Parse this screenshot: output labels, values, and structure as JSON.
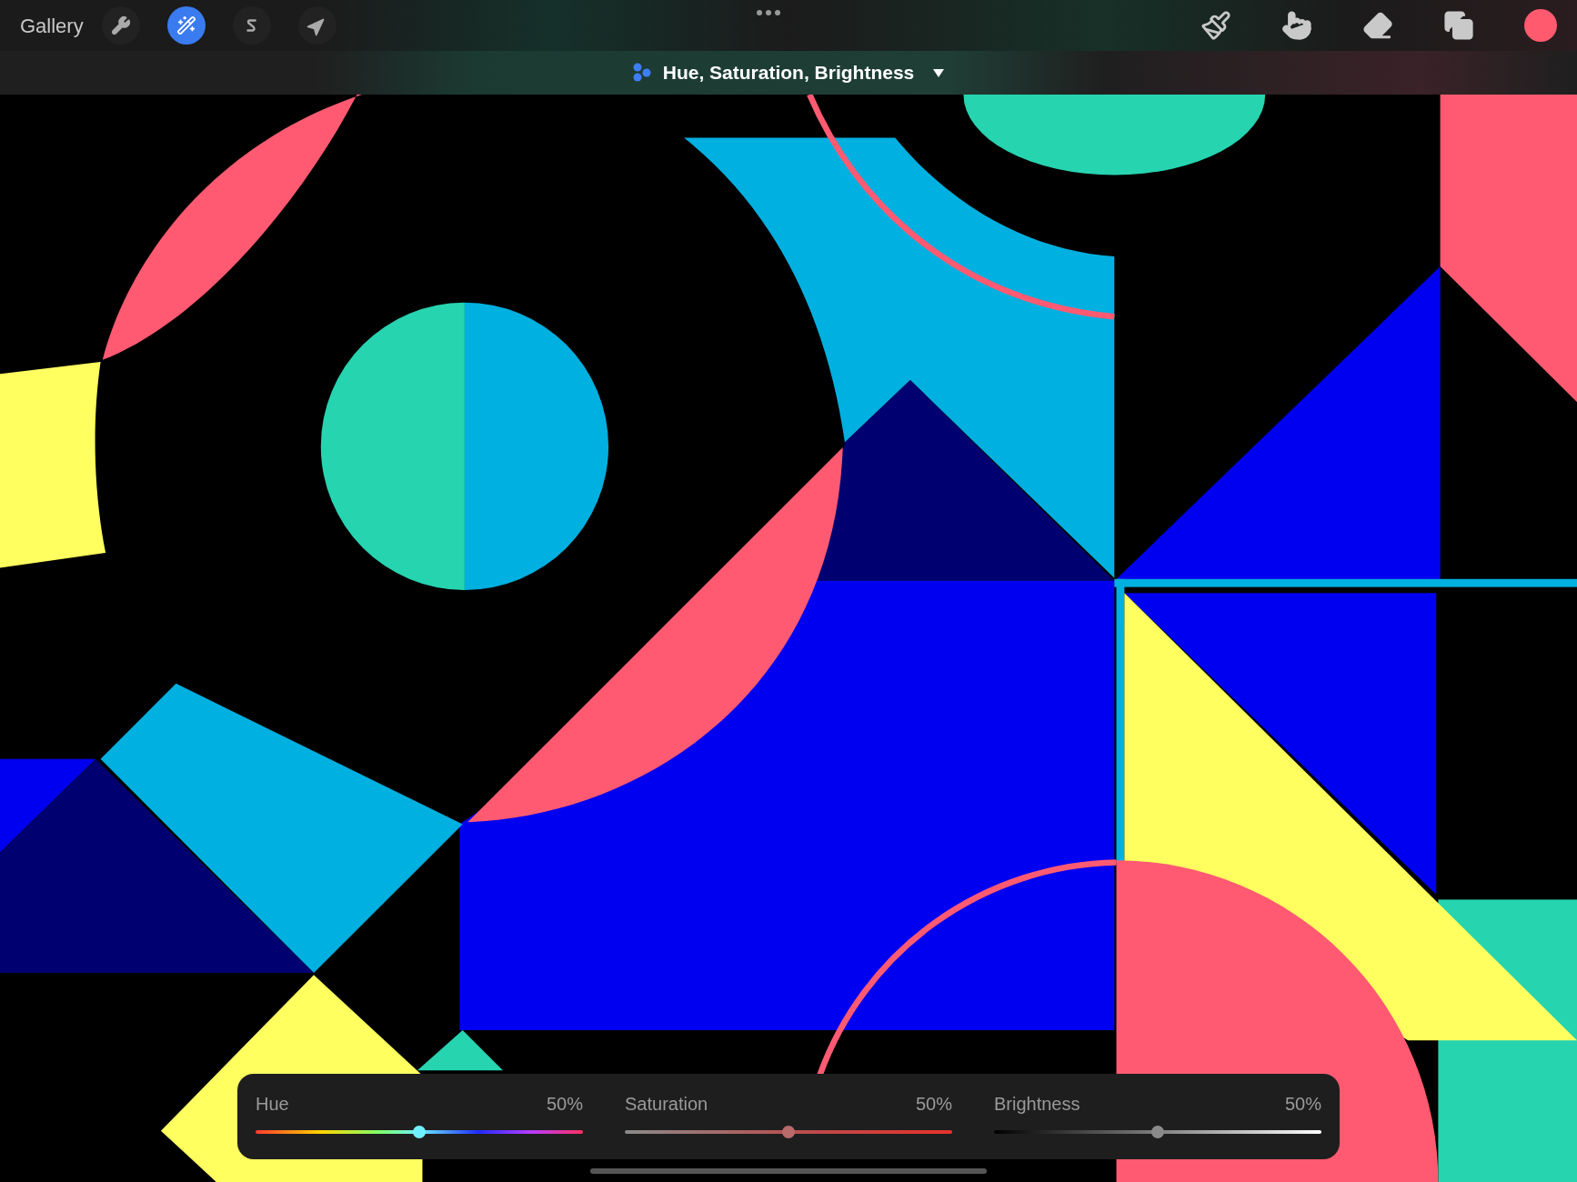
{
  "toolbar": {
    "gallery": "Gallery",
    "tools": [
      {
        "kind": "wrench",
        "selected": false
      },
      {
        "kind": "wand",
        "selected": true
      },
      {
        "kind": "selection",
        "selected": false
      },
      {
        "kind": "transform",
        "selected": false
      }
    ],
    "paint_tools": [
      {
        "kind": "brush"
      },
      {
        "kind": "smudge"
      },
      {
        "kind": "eraser"
      },
      {
        "kind": "layers"
      }
    ],
    "color": "#ff5a6e"
  },
  "adjustment": {
    "title": "Hue, Saturation, Brightness"
  },
  "sliders": [
    {
      "kind": "hue",
      "label": "Hue",
      "reading": "50%",
      "level": 0.5
    },
    {
      "kind": "saturation",
      "label": "Saturation",
      "reading": "50%",
      "level": 0.5
    },
    {
      "kind": "brightness",
      "label": "Brightness",
      "reading": "50%",
      "level": 0.5
    }
  ]
}
